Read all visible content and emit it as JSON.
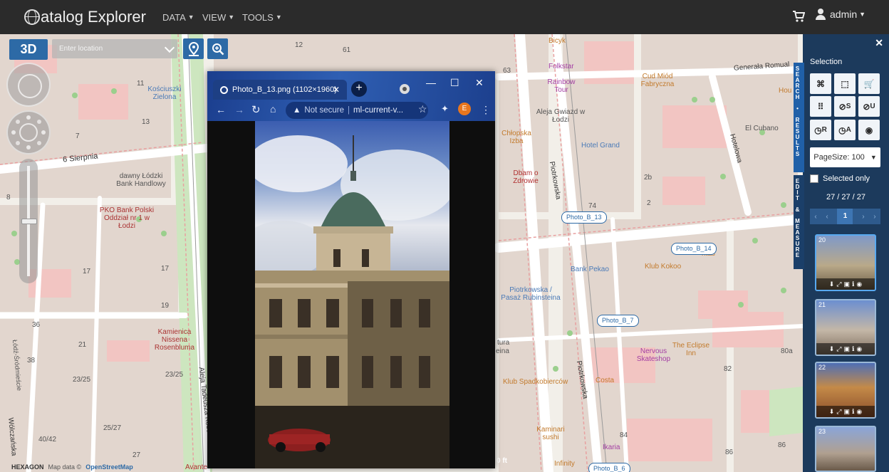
{
  "navbar": {
    "brand": "atalog Explorer",
    "menus": [
      "DATA",
      "VIEW",
      "TOOLS"
    ],
    "user": "admin"
  },
  "controls": {
    "mode_3d": "3D",
    "location_placeholder": "Enter location"
  },
  "attribution": {
    "logo": "HEXAGON",
    "map_data": "Map data ©",
    "osm": "OpenStreetMap"
  },
  "map": {
    "streets": [
      "6 Sierpnia",
      "Aleja Tadeusza Kościu",
      "Piotrkowska",
      "Piotrkowska",
      "Hotelowa",
      "Generała Romual",
      "Wólczańska",
      "Łódź-Śródmieście"
    ],
    "labels": [
      "dawny Łódzki Bank Handlowy",
      "PKO Bank Polski Oddział nr 1 w Łodzi",
      "Kamienica Nissena Rosenbluma",
      "Bank Pekao",
      "Klub Kokoo",
      "El Cubano",
      "Hotel Grand",
      "Aleja Gwiazd w Łodzi",
      "Folkstar",
      "Rainbow Tour",
      "Cud Miód Fabryczna",
      "Chłopska Izba",
      "Dbam o Zdrowie",
      "Piotrkowska / Pasaż Rubinsteina",
      "Nervous Skateshop",
      "The Eclipse Inn",
      "Klub Spadkobierców",
      "Costa",
      "Kaminari sushi",
      "Ikaria",
      "Infinity",
      "Avante",
      "Kościuszki Zielona",
      "tura",
      "eina",
      "Hou"
    ],
    "numbers": [
      "12",
      "61",
      "11",
      "13",
      "7",
      "8",
      "17",
      "17",
      "19",
      "36",
      "21",
      "38",
      "23/25",
      "23/25",
      "25/27",
      "40/42",
      "27",
      "63",
      "74",
      "2",
      "2b",
      "80a",
      "82",
      "84",
      "86",
      "86",
      "ntas"
    ],
    "photo_markers": [
      "Photo_B_13",
      "Photo_B_14",
      "Photo_B_7",
      "Photo_B_6"
    ],
    "scale_text": "0 ft",
    "cafe_label": "Bicyk"
  },
  "popup": {
    "tab_title": "Photo_B_13.png (1102×1960)",
    "security": "Not secure",
    "url": "ml-current-v...",
    "avatar_letter": "E"
  },
  "panel": {
    "selection_label": "Selection",
    "page_size": "PageSize: 100",
    "selected_only": "Selected only",
    "count": "27 / 27 / 27",
    "current_page": "1",
    "tab_search": "SEARCH • RESULTS",
    "tab_edit": "EDIT & MEASURE",
    "tools_sup": [
      "S",
      "U",
      "R",
      "A"
    ],
    "thumbs": [
      "20",
      "21",
      "22",
      "23"
    ]
  }
}
